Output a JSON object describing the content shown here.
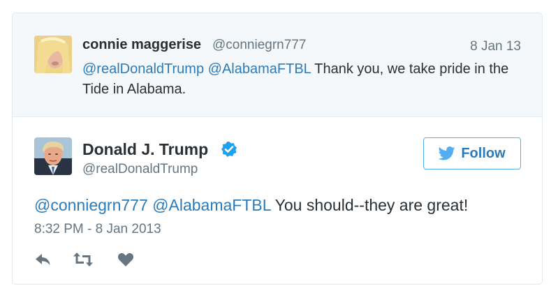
{
  "in_reply_to": {
    "avatar_icon": "user-avatar-blonde",
    "name": "connie maggerise",
    "handle": "@conniegrn777",
    "date": "8 Jan 13",
    "mention_1": "@realDonaldTrump",
    "mention_2": "@AlabamaFTBL",
    "text": "Thank you, we take pride in the Tide in Alabama."
  },
  "tweet": {
    "avatar_icon": "user-avatar-portrait",
    "name": "Donald J. Trump",
    "verified_icon": "verified-badge-icon",
    "handle": "@realDonaldTrump",
    "follow_label": "Follow",
    "mention_1": "@conniegrn777",
    "mention_2": "@AlabamaFTBL",
    "text": "You should--they are great!",
    "timestamp": "8:32 PM - 8 Jan 2013"
  },
  "actions": [
    "reply-icon",
    "retweet-icon",
    "like-icon"
  ],
  "colors": {
    "link": "#2b7bb9",
    "follow_border": "#55acee",
    "verified": "#1da1f2",
    "muted": "#66757f",
    "reply_background": "#f5f8fa"
  }
}
